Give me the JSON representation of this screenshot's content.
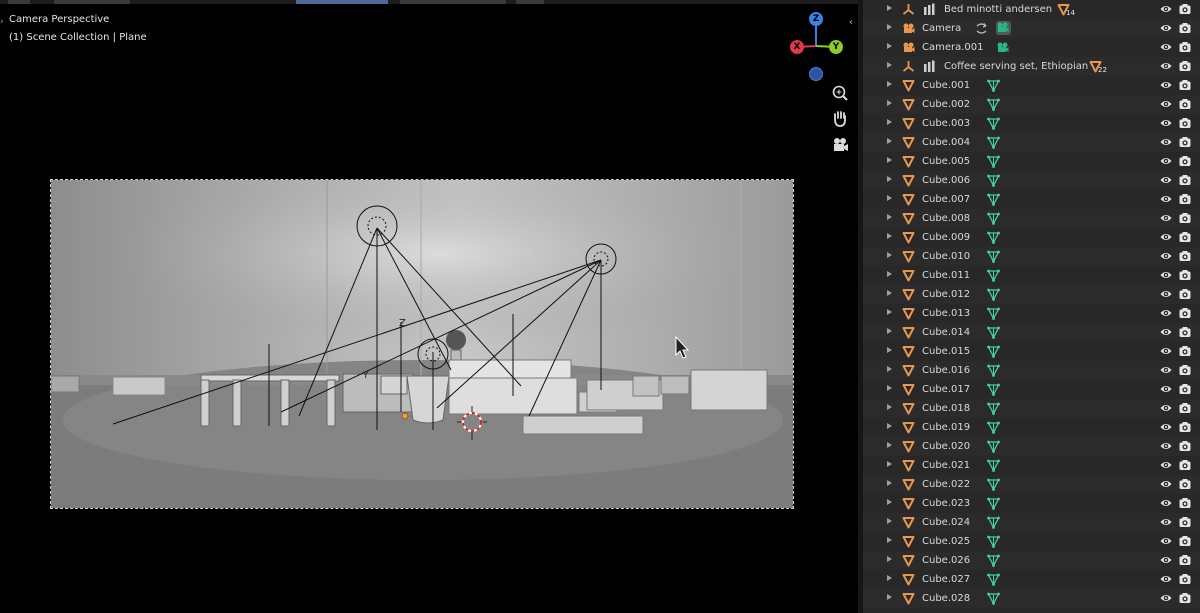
{
  "viewport": {
    "title": "Camera Perspective",
    "subtitle": "(1) Scene Collection | Plane",
    "gizmo": {
      "z": "Z",
      "x": "X",
      "y": "Y"
    },
    "tools": [
      "zoom-icon",
      "pan-hand-icon",
      "camera-view-icon"
    ]
  },
  "outliner": {
    "rows": [
      {
        "label": "Bed minotti andersen",
        "type": "empty",
        "data": "mesh-orange",
        "badge": "14"
      },
      {
        "label": "Camera",
        "type": "camera",
        "data": "camera-data"
      },
      {
        "label": "Camera.001",
        "type": "camera",
        "data": "camera-data"
      },
      {
        "label": "Coffee serving set, Ethiopian",
        "type": "empty",
        "data": "mesh-orange",
        "badge": "22"
      },
      {
        "label": "Cube.001",
        "type": "mesh",
        "data": "mesh-green"
      },
      {
        "label": "Cube.002",
        "type": "mesh",
        "data": "mesh-green"
      },
      {
        "label": "Cube.003",
        "type": "mesh",
        "data": "mesh-green"
      },
      {
        "label": "Cube.004",
        "type": "mesh",
        "data": "mesh-green"
      },
      {
        "label": "Cube.005",
        "type": "mesh",
        "data": "mesh-green"
      },
      {
        "label": "Cube.006",
        "type": "mesh",
        "data": "mesh-green"
      },
      {
        "label": "Cube.007",
        "type": "mesh",
        "data": "mesh-green"
      },
      {
        "label": "Cube.008",
        "type": "mesh",
        "data": "mesh-green"
      },
      {
        "label": "Cube.009",
        "type": "mesh",
        "data": "mesh-green"
      },
      {
        "label": "Cube.010",
        "type": "mesh",
        "data": "mesh-green"
      },
      {
        "label": "Cube.011",
        "type": "mesh",
        "data": "mesh-green"
      },
      {
        "label": "Cube.012",
        "type": "mesh",
        "data": "mesh-green"
      },
      {
        "label": "Cube.013",
        "type": "mesh",
        "data": "mesh-green"
      },
      {
        "label": "Cube.014",
        "type": "mesh",
        "data": "mesh-green"
      },
      {
        "label": "Cube.015",
        "type": "mesh",
        "data": "mesh-green"
      },
      {
        "label": "Cube.016",
        "type": "mesh",
        "data": "mesh-green"
      },
      {
        "label": "Cube.017",
        "type": "mesh",
        "data": "mesh-green"
      },
      {
        "label": "Cube.018",
        "type": "mesh",
        "data": "mesh-green"
      },
      {
        "label": "Cube.019",
        "type": "mesh",
        "data": "mesh-green"
      },
      {
        "label": "Cube.020",
        "type": "mesh",
        "data": "mesh-green"
      },
      {
        "label": "Cube.021",
        "type": "mesh",
        "data": "mesh-green"
      },
      {
        "label": "Cube.022",
        "type": "mesh",
        "data": "mesh-green"
      },
      {
        "label": "Cube.023",
        "type": "mesh",
        "data": "mesh-green"
      },
      {
        "label": "Cube.024",
        "type": "mesh",
        "data": "mesh-green"
      },
      {
        "label": "Cube.025",
        "type": "mesh",
        "data": "mesh-green"
      },
      {
        "label": "Cube.026",
        "type": "mesh",
        "data": "mesh-green"
      },
      {
        "label": "Cube.027",
        "type": "mesh",
        "data": "mesh-green"
      },
      {
        "label": "Cube.028",
        "type": "mesh",
        "data": "mesh-green"
      }
    ]
  },
  "colors": {
    "mesh_orange": "#e8984a",
    "mesh_green": "#3fd69b",
    "camera_data": "#2bb38a",
    "axis_x": "#e2384f",
    "axis_y": "#8bce1f",
    "axis_z": "#3a83e0"
  }
}
